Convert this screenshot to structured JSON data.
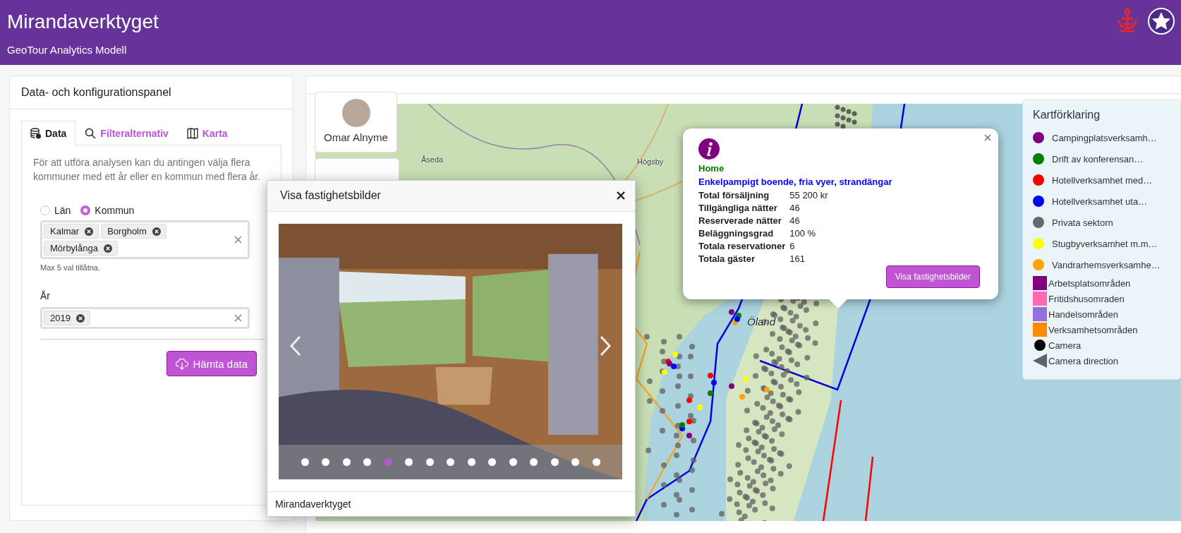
{
  "header": {
    "title": "Mirandaverktyget",
    "subtitle": "GeoTour Analytics Modell"
  },
  "panel": {
    "title": "Data- och konfigurationspanel",
    "tabs": [
      {
        "label": "Data",
        "kind": "database",
        "selected": true
      },
      {
        "label": "Filteralternativ",
        "kind": "search",
        "selected": false
      },
      {
        "label": "Karta",
        "kind": "map",
        "selected": false
      }
    ],
    "intro": "För att utföra analysen kan du antingen välja flera kommuner med ett år eller en kommun med flera år.",
    "scope_options": [
      {
        "label": "Län",
        "selected": false
      },
      {
        "label": "Kommun",
        "selected": true
      }
    ],
    "municipalities": {
      "tags": [
        "Kalmar",
        "Borgholm",
        "Mörbylånga"
      ],
      "hint": "Max 5 val tillåtna."
    },
    "year": {
      "label": "År",
      "tags": [
        "2019"
      ]
    },
    "fetch_button": "Hämta data"
  },
  "map": {
    "user": {
      "name": "Omar Alnyme"
    },
    "place_labels": [
      "Åseda",
      "Högsby",
      "Öland"
    ],
    "popup": {
      "category": "Home",
      "description": "Enkelpampigt boende, fria vyer, strandängar",
      "rows": [
        {
          "label": "Total försäljning",
          "value": "55 200 kr"
        },
        {
          "label": "Tillgängliga nätter",
          "value": "46"
        },
        {
          "label": "Reserverade nätter",
          "value": "46"
        },
        {
          "label": "Beläggningsgrad",
          "value": "100 %"
        },
        {
          "label": "Totala reservationer",
          "value": "6"
        },
        {
          "label": "Totala gäster",
          "value": "161"
        }
      ],
      "button": "Visa fastighetsbilder"
    },
    "legend": {
      "title": "Kartförklaring",
      "items": [
        {
          "kind": "dot",
          "label": "Campingplatsverksamh…",
          "color": "#800080"
        },
        {
          "kind": "dot",
          "label": "Drift av konferensan…",
          "color": "#008000"
        },
        {
          "kind": "dot",
          "label": "Hotellverksamhet med…",
          "color": "#ff0000"
        },
        {
          "kind": "dot",
          "label": "Hotellverksamhet uta…",
          "color": "#0000ff"
        },
        {
          "kind": "dot",
          "label": "Privata sektorn",
          "color": "#696969"
        },
        {
          "kind": "dot",
          "label": "Stugbyverksamhet m.m…",
          "color": "#ffff00"
        },
        {
          "kind": "dot",
          "label": "Vandrarhemsverksamhe…",
          "color": "#ffa500"
        },
        {
          "kind": "square",
          "label": "Arbetsplatsområden",
          "color": "#800080"
        },
        {
          "kind": "square",
          "label": "Fritidshusomraden",
          "color": "#ff69b4"
        },
        {
          "kind": "square",
          "label": "Handelsområden",
          "color": "#9370db"
        },
        {
          "kind": "square",
          "label": "Verksamhetsområden",
          "color": "#ff8c00"
        },
        {
          "kind": "small-dot",
          "label": "Camera",
          "color": "#000000"
        },
        {
          "kind": "triangle",
          "label": "Camera direction",
          "color": "#5f6368"
        }
      ]
    }
  },
  "modal": {
    "title": "Visa fastighetsbilder",
    "indicators": [
      {
        "selected": false
      },
      {
        "selected": false
      },
      {
        "selected": false
      },
      {
        "selected": false
      },
      {
        "selected": true
      },
      {
        "selected": false
      },
      {
        "selected": false
      },
      {
        "selected": false
      },
      {
        "selected": false
      },
      {
        "selected": false
      },
      {
        "selected": false
      },
      {
        "selected": false
      },
      {
        "selected": false
      },
      {
        "selected": false
      },
      {
        "selected": false
      }
    ],
    "footer": "Mirandaverktyget"
  }
}
